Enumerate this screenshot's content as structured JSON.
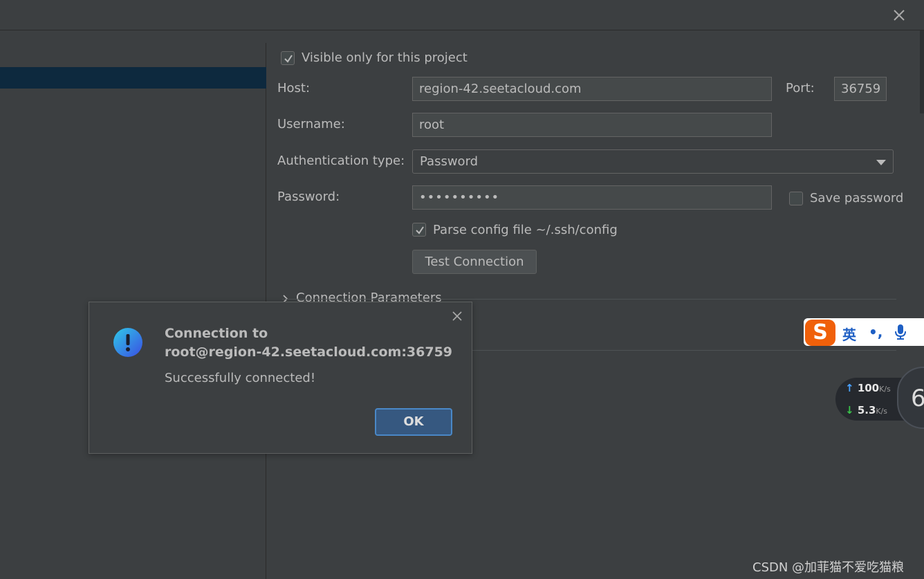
{
  "form": {
    "visible_only_label": "Visible only for this project",
    "visible_only_checked": true,
    "host_label": "Host:",
    "host_value": "region-42.seetacloud.com",
    "port_label": "Port:",
    "port_value": "36759",
    "username_label": "Username:",
    "username_value": "root",
    "auth_type_label": "Authentication type:",
    "auth_type_value": "Password",
    "password_label": "Password:",
    "password_value": "••••••••••",
    "save_password_label": "Save password",
    "save_password_checked": false,
    "parse_config_label": "Parse config file ~/.ssh/config",
    "parse_config_checked": true,
    "test_connection_label": "Test Connection",
    "connection_params_label": "Connection Parameters"
  },
  "dialog": {
    "title_line1": "Connection to",
    "title_line2": "root@region-42.seetacloud.com:36759",
    "message": "Successfully connected!",
    "ok_label": "OK",
    "icon": "info-exclamation-icon"
  },
  "ime_toolbar": {
    "logo": "S",
    "lang": "英",
    "punct": "•,",
    "mic_icon": "microphone-icon"
  },
  "net_monitor": {
    "upload_value": "100",
    "upload_unit": "K/s",
    "download_value": "5.3",
    "download_unit": "K/s",
    "gauge_value": "6"
  },
  "watermark": "CSDN @加菲猫不爱吃猫粮"
}
